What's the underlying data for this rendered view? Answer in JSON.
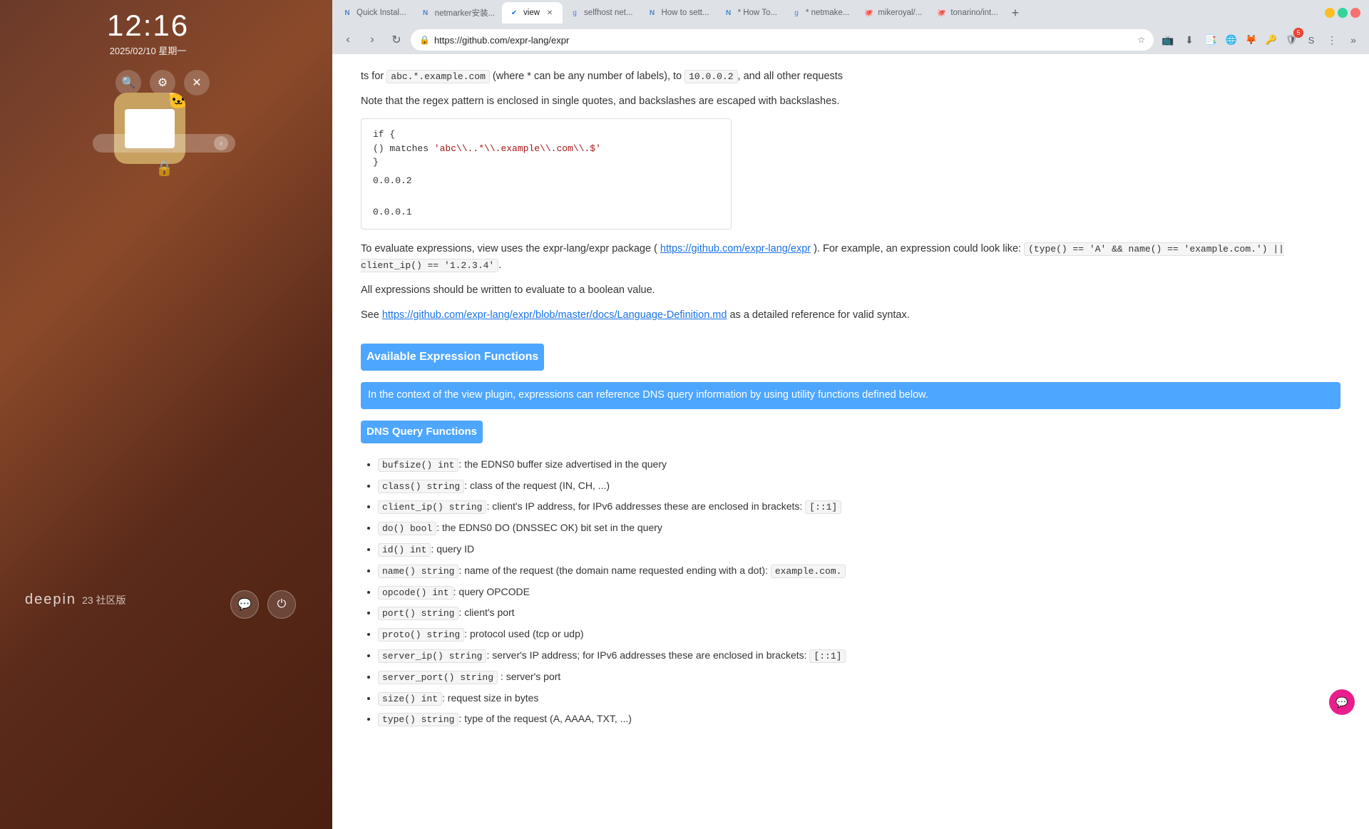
{
  "desktop": {
    "clock": {
      "time": "12:16",
      "date": "2025/02/10 星期一"
    },
    "brand": {
      "logo": "deepin",
      "version": "23 社区版"
    }
  },
  "browser": {
    "tabs": [
      {
        "id": "tab1",
        "label": "Quick Instal...",
        "favicon": "N",
        "active": false
      },
      {
        "id": "tab2",
        "label": "netmarker安装...",
        "favicon": "N",
        "active": false
      },
      {
        "id": "tab3",
        "label": "view",
        "favicon": "✔",
        "active": true,
        "closeable": true
      },
      {
        "id": "tab4",
        "label": "selfhost net...",
        "favicon": "g",
        "active": false
      },
      {
        "id": "tab5",
        "label": "How to sett...",
        "favicon": "N",
        "active": false
      },
      {
        "id": "tab6",
        "label": "* How To...",
        "favicon": "N",
        "active": false
      },
      {
        "id": "tab7",
        "label": "* netmake...",
        "favicon": "g",
        "active": false
      },
      {
        "id": "tab8",
        "label": "mikeroyal/...",
        "favicon": "🐙",
        "active": false
      },
      {
        "id": "tab9",
        "label": "tonarino/int...",
        "favicon": "🐙",
        "active": false
      }
    ],
    "address": "https://github.com/expr-lang/expr",
    "page": {
      "intro_text": "ts for abc.*.example.com (where * can be any number of labels), to 10.0.0.2, and all other requests",
      "intro_text2": "Note that the regex pattern is enclosed in single quotes, and backslashes are escaped with backslashes.",
      "code_block1": "  if {\n    () matches 'abc\\\\..*\\\\.example\\\\.com\\\\.\\$'\n  }",
      "code_line": "0.0.0.2",
      "code_line2": "0.0.0.1",
      "para1": "To evaluate expressions, view uses the expr-lang/expr package (",
      "link1": "https://github.com/expr-lang/expr",
      "para1_mid": "). For example, an",
      "para1_cont": "expression could look like:",
      "code_expr": "(type() == 'A' && name() == 'example.com.') || client_ip() == '1.2.3.4'.",
      "para2": "All expressions should be written to evaluate to a boolean value.",
      "para3": "See ",
      "link2": "https://github.com/expr-lang/expr/blob/master/docs/Language-Definition.md",
      "para3_cont": " as a detailed reference for valid syntax.",
      "heading_expr": "Available Expression Functions",
      "highlight_para": "In the context of the view plugin, expressions can reference DNS query information by using utility functions defined below.",
      "heading_dns": "DNS Query Functions",
      "functions": [
        {
          "sig": "bufsize() int",
          "desc": ": the EDNS0 buffer size advertised in the query"
        },
        {
          "sig": "class() string",
          "desc": ": class of the request (IN, CH, ...)"
        },
        {
          "sig": "client_ip() string",
          "desc": ": client's IP address, for IPv6 addresses these are enclosed in brackets: [::1]"
        },
        {
          "sig": "do() bool",
          "desc": ": the EDNS0 DO (DNSSEC OK) bit set in the query"
        },
        {
          "sig": "id() int",
          "desc": ": query ID"
        },
        {
          "sig": "name() string",
          "desc": ": name of the request (the domain name requested ending with a dot):",
          "example": "example.com."
        },
        {
          "sig": "opcode() int",
          "desc": ": query OPCODE"
        },
        {
          "sig": "port() string",
          "desc": ": client's port"
        },
        {
          "sig": "proto() string",
          "desc": ": protocol used (tcp or udp)"
        },
        {
          "sig": "server_ip() string",
          "desc": ": server's IP address; for IPv6 addresses these are enclosed in brackets: [::1]"
        },
        {
          "sig": "server_port() string",
          "desc": " : server's port"
        },
        {
          "sig": "size() int",
          "desc": ": request size in bytes"
        },
        {
          "sig": "type() string",
          "desc": ": type of the request (A, AAAA, TXT, ...)"
        }
      ]
    }
  }
}
